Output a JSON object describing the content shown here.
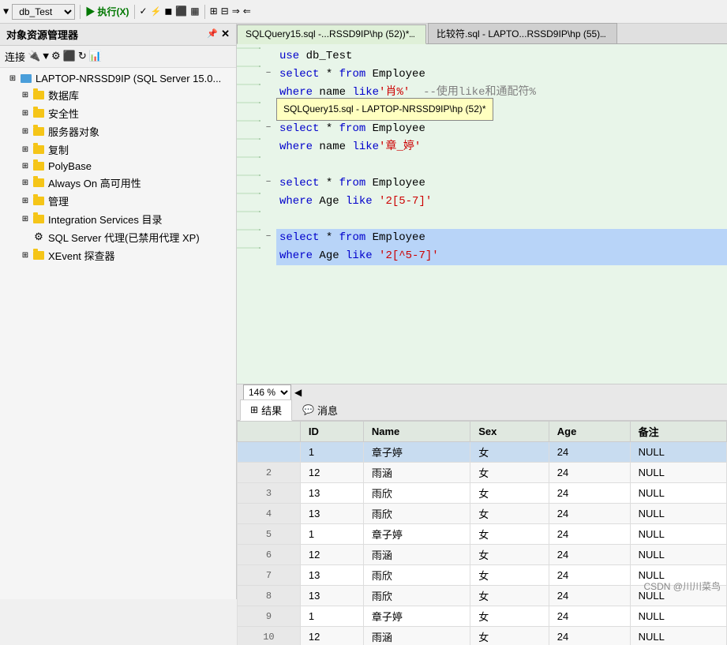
{
  "toolbar": {
    "db_label": "db_Test",
    "execute_label": "执行(X)"
  },
  "left_panel": {
    "title": "对象资源管理器",
    "connect_label": "连接",
    "server_node": "LAPTOP-NRSSD9IP (SQL Server 15.0...",
    "items": [
      {
        "label": "数据库",
        "indent": 2,
        "has_children": true
      },
      {
        "label": "安全性",
        "indent": 2,
        "has_children": true
      },
      {
        "label": "服务器对象",
        "indent": 2,
        "has_children": true
      },
      {
        "label": "复制",
        "indent": 2,
        "has_children": true
      },
      {
        "label": "PolyBase",
        "indent": 2,
        "has_children": true
      },
      {
        "label": "Always On 高可用性",
        "indent": 2,
        "has_children": true
      },
      {
        "label": "管理",
        "indent": 2,
        "has_children": true
      },
      {
        "label": "Integration Services 目录",
        "indent": 2,
        "has_children": true
      },
      {
        "label": "SQL Server 代理(已禁用代理 XP)",
        "indent": 2,
        "has_children": false
      },
      {
        "label": "XEvent 探查器",
        "indent": 2,
        "has_children": true
      }
    ]
  },
  "tabs": [
    {
      "label": "SQLQuery15.sql -...RSSD9IP\\hp (52))*",
      "active": true
    },
    {
      "label": "比较符.sql - LAPTO...RSSD9IP\\hp (55)",
      "active": false
    }
  ],
  "autocomplete": {
    "text": "SQLQuery15.sql - LAPTOP-NRSSD9IP\\hp (52)*"
  },
  "editor": {
    "lines": [
      {
        "num": "",
        "collapse": "",
        "content": "use db_Test",
        "highlight": false
      },
      {
        "num": "",
        "collapse": "−",
        "content": "select * from Employee",
        "highlight": false
      },
      {
        "num": "",
        "collapse": "",
        "content": "where name like'肖%'  --使用like和通配符%",
        "highlight": false
      },
      {
        "num": "",
        "collapse": "",
        "content": "",
        "highlight": false
      },
      {
        "num": "",
        "collapse": "−",
        "content": "select * from Employee",
        "highlight": false
      },
      {
        "num": "",
        "collapse": "",
        "content": "where name like'章_婷'",
        "highlight": false
      },
      {
        "num": "",
        "collapse": "",
        "content": "",
        "highlight": false
      },
      {
        "num": "",
        "collapse": "−",
        "content": "select * from Employee",
        "highlight": false
      },
      {
        "num": "",
        "collapse": "",
        "content": "where Age like '2[5-7]'",
        "highlight": false
      },
      {
        "num": "",
        "collapse": "",
        "content": "",
        "highlight": false
      },
      {
        "num": "",
        "collapse": "−",
        "content": "select * from Employee",
        "highlight": true
      },
      {
        "num": "",
        "collapse": "",
        "content": "where Age like '2[^5-7]'",
        "highlight": true
      }
    ]
  },
  "zoom": {
    "level": "146 %"
  },
  "results": {
    "tabs": [
      {
        "label": "结果",
        "icon": "grid",
        "active": true
      },
      {
        "label": "消息",
        "icon": "msg",
        "active": false
      }
    ],
    "columns": [
      "",
      "ID",
      "Name",
      "Sex",
      "Age",
      "备注"
    ],
    "rows": [
      {
        "row_num": "",
        "id": "1",
        "name": "章子婷",
        "sex": "女",
        "age": "24",
        "note": "NULL",
        "selected": true
      },
      {
        "row_num": "2",
        "id": "12",
        "name": "雨涵",
        "sex": "女",
        "age": "24",
        "note": "NULL",
        "selected": false
      },
      {
        "row_num": "3",
        "id": "13",
        "name": "雨欣",
        "sex": "女",
        "age": "24",
        "note": "NULL",
        "selected": false
      },
      {
        "row_num": "4",
        "id": "13",
        "name": "雨欣",
        "sex": "女",
        "age": "24",
        "note": "NULL",
        "selected": false
      },
      {
        "row_num": "5",
        "id": "1",
        "name": "章子婷",
        "sex": "女",
        "age": "24",
        "note": "NULL",
        "selected": false
      },
      {
        "row_num": "6",
        "id": "12",
        "name": "雨涵",
        "sex": "女",
        "age": "24",
        "note": "NULL",
        "selected": false
      },
      {
        "row_num": "7",
        "id": "13",
        "name": "雨欣",
        "sex": "女",
        "age": "24",
        "note": "NULL",
        "selected": false
      },
      {
        "row_num": "8",
        "id": "13",
        "name": "雨欣",
        "sex": "女",
        "age": "24",
        "note": "NULL",
        "selected": false
      },
      {
        "row_num": "9",
        "id": "1",
        "name": "章子婷",
        "sex": "女",
        "age": "24",
        "note": "NULL",
        "selected": false
      },
      {
        "row_num": "10",
        "id": "12",
        "name": "雨涵",
        "sex": "女",
        "age": "24",
        "note": "NULL",
        "selected": false
      }
    ]
  },
  "watermark": "CSDN @川川菜鸟"
}
